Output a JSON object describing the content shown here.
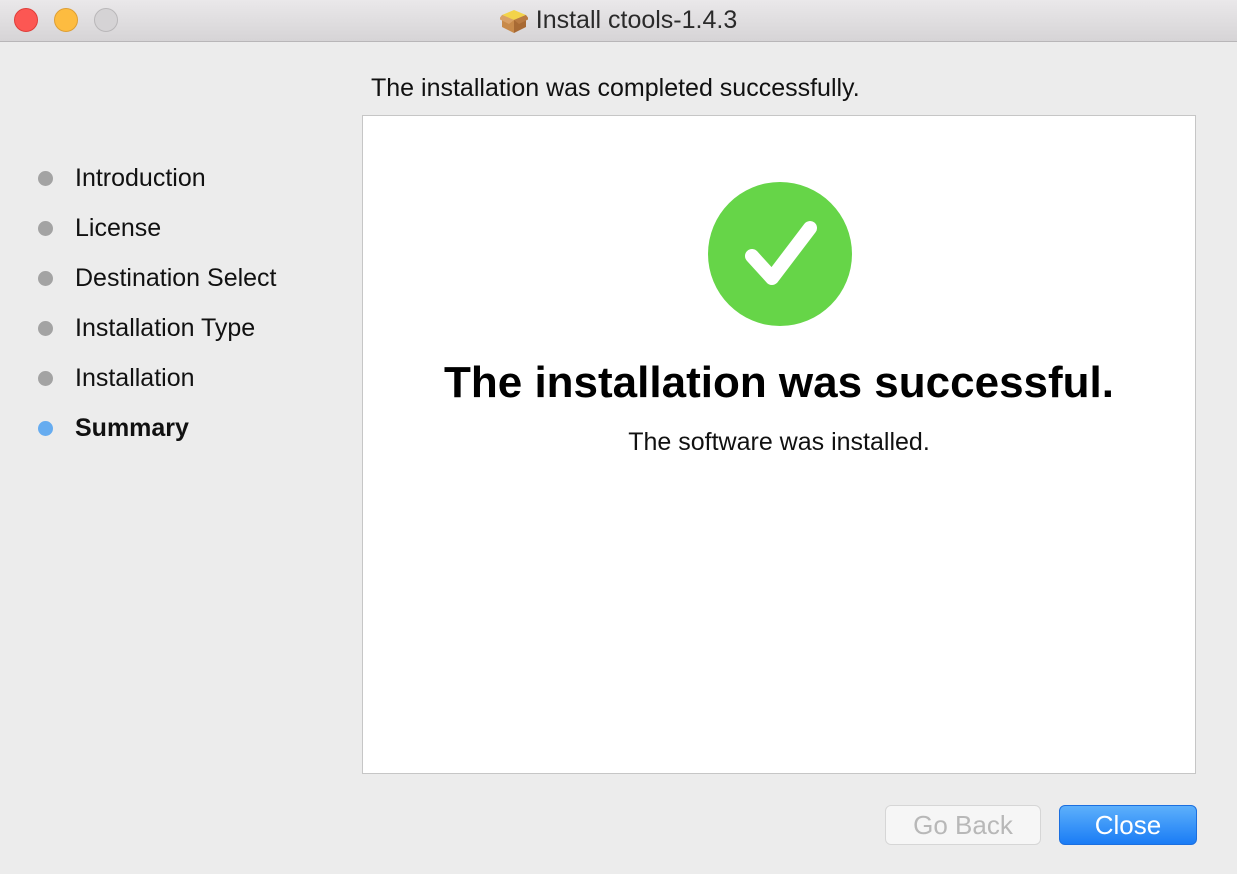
{
  "window": {
    "title": "Install ctools-1.4.3",
    "title_icon": "package-icon",
    "controls": [
      "close",
      "minimize",
      "zoom"
    ]
  },
  "sidebar": {
    "steps": [
      {
        "label": "Introduction",
        "state": "done"
      },
      {
        "label": "License",
        "state": "done"
      },
      {
        "label": "Destination Select",
        "state": "done"
      },
      {
        "label": "Installation Type",
        "state": "done"
      },
      {
        "label": "Installation",
        "state": "done"
      },
      {
        "label": "Summary",
        "state": "current"
      }
    ]
  },
  "main": {
    "header": "The installation was completed successfully.",
    "status_icon": "checkmark-circle-icon",
    "title": "The installation was successful.",
    "subtitle": "The software was installed."
  },
  "buttons": {
    "go_back": {
      "label": "Go Back",
      "enabled": false
    },
    "close": {
      "label": "Close",
      "enabled": true,
      "default": true
    }
  },
  "colors": {
    "success_green": "#66d548",
    "active_step": "#66acf0",
    "inactive_step": "#a3a3a3",
    "primary_button": "#1a7cf5"
  }
}
